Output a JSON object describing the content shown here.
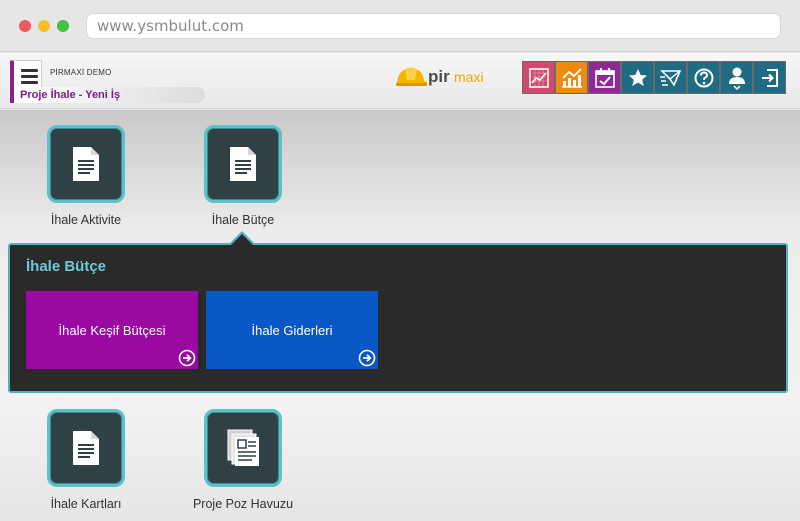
{
  "browser": {
    "url": "www.ysmbulut.com"
  },
  "header": {
    "company": "PİRMAXİ DEMO",
    "breadcrumb": "Proje İhale - Yeni İş",
    "logo": {
      "pir": "pir",
      "maxi": "maxi"
    },
    "toolbar": [
      {
        "icon": "report-chart-icon",
        "color": "#d04a6b"
      },
      {
        "icon": "trend-chart-icon",
        "color": "#ee8a10"
      },
      {
        "icon": "calendar-check-icon",
        "color": "#8f2a92"
      },
      {
        "icon": "star-icon",
        "color": "#1f6b83"
      },
      {
        "icon": "message-icon",
        "color": "#1f6b83"
      },
      {
        "icon": "help-icon",
        "color": "#1f6b83"
      },
      {
        "icon": "user-icon",
        "color": "#1f6b83"
      },
      {
        "icon": "logout-icon",
        "color": "#1f6b83"
      }
    ]
  },
  "modules": [
    {
      "label": "İhale Aktivite",
      "icon": "document-icon"
    },
    {
      "label": "İhale Bütçe",
      "icon": "document-icon"
    },
    {
      "label": "İhale Kartları",
      "icon": "document-icon"
    },
    {
      "label": "Proje Poz Havuzu",
      "icon": "documents-stack-icon"
    }
  ],
  "panel": {
    "title": "İhale Bütçe",
    "cards": [
      {
        "label": "İhale Keşif Bütçesi",
        "color": "#9a0aa3"
      },
      {
        "label": "İhale Giderleri",
        "color": "#0a57c8"
      }
    ]
  },
  "colors": {
    "accent": "#8d1f8a",
    "teal": "#4fb2c3"
  }
}
